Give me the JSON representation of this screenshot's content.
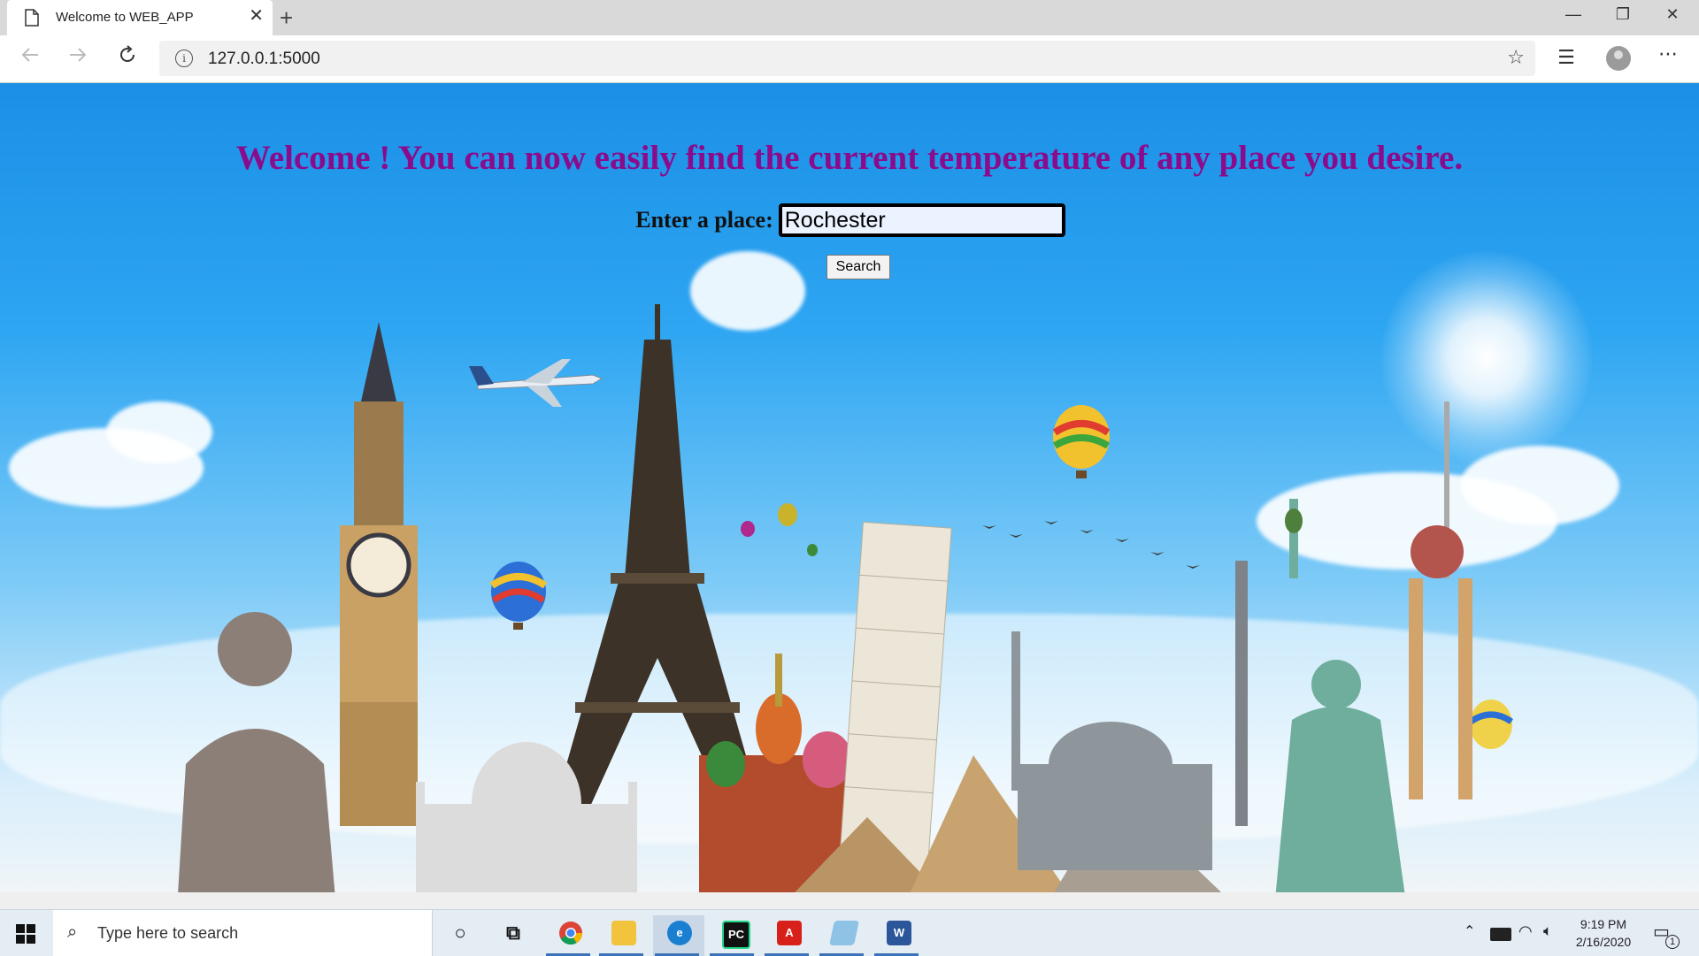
{
  "browser": {
    "tab_title": "Welcome to WEB_APP",
    "tab_close_glyph": "✕",
    "new_tab_glyph": "+",
    "url": "127.0.0.1:5000",
    "window_controls": [
      "—",
      "❐",
      "✕"
    ],
    "icons": [
      "page-icon",
      "back-icon",
      "forward-icon",
      "refresh-icon",
      "info-icon",
      "favorite-star-icon",
      "favorites-list-icon",
      "profile-avatar-icon",
      "more-menu-icon"
    ]
  },
  "page": {
    "headline": "Welcome ! You can now easily find the current temperature of any place you desire.",
    "place_label": "Enter a place:",
    "place_value": "Rochester",
    "search_button": "Search",
    "headline_color": "#8a0c8c"
  },
  "taskbar": {
    "search_placeholder": "Type here to search",
    "apps": [
      {
        "name": "cortana",
        "glyph": "○"
      },
      {
        "name": "task-view",
        "glyph": "⧉"
      },
      {
        "name": "chrome",
        "glyph": ""
      },
      {
        "name": "file-explorer",
        "glyph": ""
      },
      {
        "name": "edge",
        "glyph": "e"
      },
      {
        "name": "pycharm",
        "glyph": "PC"
      },
      {
        "name": "acrobat",
        "glyph": "A"
      },
      {
        "name": "notepad",
        "glyph": ""
      },
      {
        "name": "word",
        "glyph": "W"
      }
    ],
    "time": "9:19 PM",
    "date": "2/16/2020",
    "notification_count": "1"
  }
}
